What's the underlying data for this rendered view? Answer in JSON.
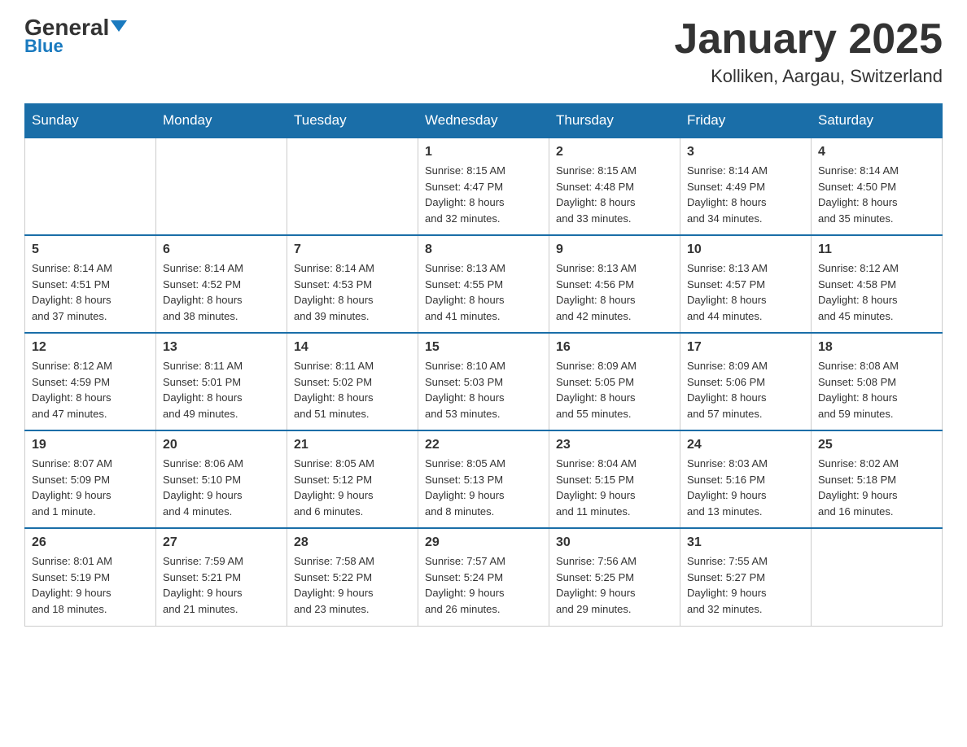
{
  "header": {
    "logo_general": "General",
    "logo_blue": "Blue",
    "month_title": "January 2025",
    "location": "Kolliken, Aargau, Switzerland"
  },
  "weekdays": [
    "Sunday",
    "Monday",
    "Tuesday",
    "Wednesday",
    "Thursday",
    "Friday",
    "Saturday"
  ],
  "rows": [
    [
      {
        "day": "",
        "info": ""
      },
      {
        "day": "",
        "info": ""
      },
      {
        "day": "",
        "info": ""
      },
      {
        "day": "1",
        "info": "Sunrise: 8:15 AM\nSunset: 4:47 PM\nDaylight: 8 hours\nand 32 minutes."
      },
      {
        "day": "2",
        "info": "Sunrise: 8:15 AM\nSunset: 4:48 PM\nDaylight: 8 hours\nand 33 minutes."
      },
      {
        "day": "3",
        "info": "Sunrise: 8:14 AM\nSunset: 4:49 PM\nDaylight: 8 hours\nand 34 minutes."
      },
      {
        "day": "4",
        "info": "Sunrise: 8:14 AM\nSunset: 4:50 PM\nDaylight: 8 hours\nand 35 minutes."
      }
    ],
    [
      {
        "day": "5",
        "info": "Sunrise: 8:14 AM\nSunset: 4:51 PM\nDaylight: 8 hours\nand 37 minutes."
      },
      {
        "day": "6",
        "info": "Sunrise: 8:14 AM\nSunset: 4:52 PM\nDaylight: 8 hours\nand 38 minutes."
      },
      {
        "day": "7",
        "info": "Sunrise: 8:14 AM\nSunset: 4:53 PM\nDaylight: 8 hours\nand 39 minutes."
      },
      {
        "day": "8",
        "info": "Sunrise: 8:13 AM\nSunset: 4:55 PM\nDaylight: 8 hours\nand 41 minutes."
      },
      {
        "day": "9",
        "info": "Sunrise: 8:13 AM\nSunset: 4:56 PM\nDaylight: 8 hours\nand 42 minutes."
      },
      {
        "day": "10",
        "info": "Sunrise: 8:13 AM\nSunset: 4:57 PM\nDaylight: 8 hours\nand 44 minutes."
      },
      {
        "day": "11",
        "info": "Sunrise: 8:12 AM\nSunset: 4:58 PM\nDaylight: 8 hours\nand 45 minutes."
      }
    ],
    [
      {
        "day": "12",
        "info": "Sunrise: 8:12 AM\nSunset: 4:59 PM\nDaylight: 8 hours\nand 47 minutes."
      },
      {
        "day": "13",
        "info": "Sunrise: 8:11 AM\nSunset: 5:01 PM\nDaylight: 8 hours\nand 49 minutes."
      },
      {
        "day": "14",
        "info": "Sunrise: 8:11 AM\nSunset: 5:02 PM\nDaylight: 8 hours\nand 51 minutes."
      },
      {
        "day": "15",
        "info": "Sunrise: 8:10 AM\nSunset: 5:03 PM\nDaylight: 8 hours\nand 53 minutes."
      },
      {
        "day": "16",
        "info": "Sunrise: 8:09 AM\nSunset: 5:05 PM\nDaylight: 8 hours\nand 55 minutes."
      },
      {
        "day": "17",
        "info": "Sunrise: 8:09 AM\nSunset: 5:06 PM\nDaylight: 8 hours\nand 57 minutes."
      },
      {
        "day": "18",
        "info": "Sunrise: 8:08 AM\nSunset: 5:08 PM\nDaylight: 8 hours\nand 59 minutes."
      }
    ],
    [
      {
        "day": "19",
        "info": "Sunrise: 8:07 AM\nSunset: 5:09 PM\nDaylight: 9 hours\nand 1 minute."
      },
      {
        "day": "20",
        "info": "Sunrise: 8:06 AM\nSunset: 5:10 PM\nDaylight: 9 hours\nand 4 minutes."
      },
      {
        "day": "21",
        "info": "Sunrise: 8:05 AM\nSunset: 5:12 PM\nDaylight: 9 hours\nand 6 minutes."
      },
      {
        "day": "22",
        "info": "Sunrise: 8:05 AM\nSunset: 5:13 PM\nDaylight: 9 hours\nand 8 minutes."
      },
      {
        "day": "23",
        "info": "Sunrise: 8:04 AM\nSunset: 5:15 PM\nDaylight: 9 hours\nand 11 minutes."
      },
      {
        "day": "24",
        "info": "Sunrise: 8:03 AM\nSunset: 5:16 PM\nDaylight: 9 hours\nand 13 minutes."
      },
      {
        "day": "25",
        "info": "Sunrise: 8:02 AM\nSunset: 5:18 PM\nDaylight: 9 hours\nand 16 minutes."
      }
    ],
    [
      {
        "day": "26",
        "info": "Sunrise: 8:01 AM\nSunset: 5:19 PM\nDaylight: 9 hours\nand 18 minutes."
      },
      {
        "day": "27",
        "info": "Sunrise: 7:59 AM\nSunset: 5:21 PM\nDaylight: 9 hours\nand 21 minutes."
      },
      {
        "day": "28",
        "info": "Sunrise: 7:58 AM\nSunset: 5:22 PM\nDaylight: 9 hours\nand 23 minutes."
      },
      {
        "day": "29",
        "info": "Sunrise: 7:57 AM\nSunset: 5:24 PM\nDaylight: 9 hours\nand 26 minutes."
      },
      {
        "day": "30",
        "info": "Sunrise: 7:56 AM\nSunset: 5:25 PM\nDaylight: 9 hours\nand 29 minutes."
      },
      {
        "day": "31",
        "info": "Sunrise: 7:55 AM\nSunset: 5:27 PM\nDaylight: 9 hours\nand 32 minutes."
      },
      {
        "day": "",
        "info": ""
      }
    ]
  ]
}
